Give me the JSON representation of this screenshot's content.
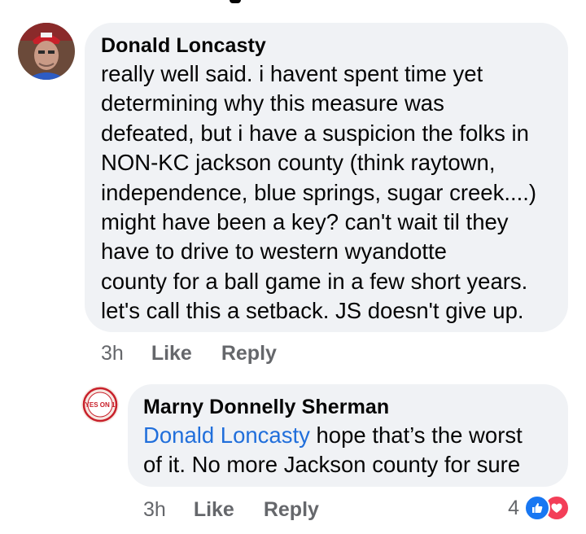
{
  "comments": [
    {
      "author": "Donald Loncasty",
      "lines": [
        "really well said.  i havent spent time yet",
        "determining why this measure was",
        "defeated, but i have a suspicion the folks in",
        "NON-KC jackson county (think raytown,",
        "independence, blue springs, sugar creek....)",
        "might have been a key? can't wait til they",
        "have to drive to western wyandotte",
        "county for a ball game in a few short years.",
        "let's call this a setback. JS doesn't give up."
      ],
      "time": "3h",
      "like_label": "Like",
      "reply_label": "Reply"
    },
    {
      "author": "Marny Donnelly Sherman",
      "mention": "Donald Loncasty",
      "line1_rest": " hope that’s the worst",
      "line2": "of it. No more Jackson county for sure",
      "avatar_text": "YES ON 1",
      "time": "3h",
      "like_label": "Like",
      "reply_label": "Reply",
      "reaction_count": "4",
      "reaction_icons": [
        "like-icon",
        "love-icon"
      ]
    }
  ],
  "colors": {
    "bubble": "#f0f2f5",
    "mention": "#216fdb",
    "meta": "#65676b",
    "like": "#1877f2",
    "love": "#f33e58"
  }
}
